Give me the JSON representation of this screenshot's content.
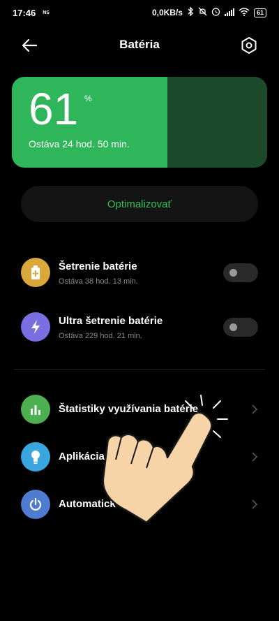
{
  "status_bar": {
    "time": "17:46",
    "ns": "NS",
    "speed": "0,0KB/s",
    "battery": "61"
  },
  "header": {
    "title": "Batéria"
  },
  "battery_card": {
    "percent": "61",
    "unit": "%",
    "fill_fraction": 0.61,
    "remaining": "Ostáva 24 hod. 50 min."
  },
  "optimize_label": "Optimalizovať",
  "modes": [
    {
      "title": "Šetrenie batérie",
      "subtitle": "Ostáva 38 hod. 13 min.",
      "icon": "battery-saver-icon",
      "color": "#d9a73a",
      "enabled": false
    },
    {
      "title": "Ultra šetrenie batérie",
      "subtitle": "Ostáva 229 hod. 21 min.",
      "icon": "lightning-icon",
      "color": "#7a6ee0",
      "enabled": false
    }
  ],
  "menu": [
    {
      "title": "Štatistiky využívania batérie",
      "icon": "bar-chart-icon",
      "color": "#4caf50"
    },
    {
      "title": "Aplikácia š",
      "icon": "lightbulb-icon",
      "color": "#3aa6e0"
    },
    {
      "title": "Automatick",
      "icon": "power-icon",
      "color": "#4f7bd0"
    }
  ]
}
